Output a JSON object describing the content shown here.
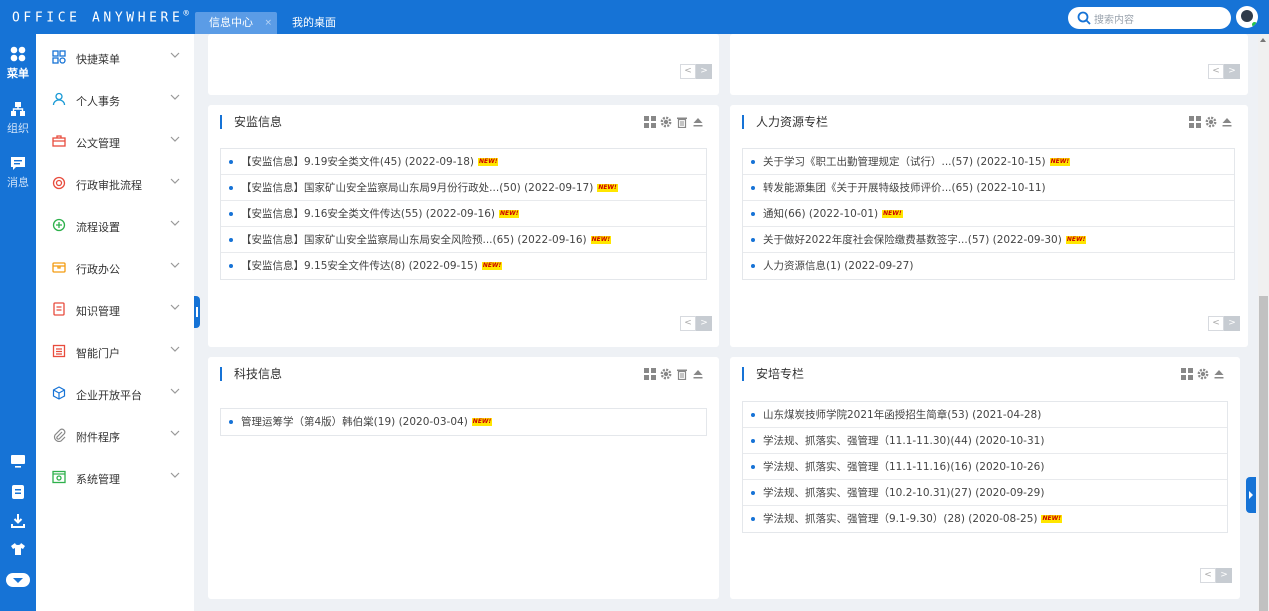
{
  "header": {
    "logo": "OFFICE ANYWHERE",
    "logo_mark": "®",
    "tabs": [
      {
        "label": "信息中心",
        "close": "×"
      },
      {
        "label": "我的桌面"
      }
    ],
    "search_placeholder": "搜索内容"
  },
  "left_nav": [
    {
      "label": "菜单",
      "icon": "apps-icon",
      "active": true
    },
    {
      "label": "组织",
      "icon": "org-icon"
    },
    {
      "label": "消息",
      "icon": "message-icon"
    }
  ],
  "left_bottom_icons": [
    "monitor-icon",
    "note-icon",
    "download-icon",
    "shirt-icon",
    "more-icon"
  ],
  "sidebar": {
    "items": [
      {
        "label": "快捷菜单",
        "icon": "grid-icon",
        "color": "#1673d6"
      },
      {
        "label": "个人事务",
        "icon": "user-icon",
        "color": "#1a9ad6"
      },
      {
        "label": "公文管理",
        "icon": "briefcase-icon",
        "color": "#e84c3d"
      },
      {
        "label": "行政审批流程",
        "icon": "stamp-icon",
        "color": "#e84c3d"
      },
      {
        "label": "流程设置",
        "icon": "flow-icon",
        "color": "#2db04b"
      },
      {
        "label": "行政办公",
        "icon": "office-icon",
        "color": "#f39c12"
      },
      {
        "label": "知识管理",
        "icon": "book-icon",
        "color": "#e84c3d"
      },
      {
        "label": "智能门户",
        "icon": "portal-icon",
        "color": "#e84c3d"
      },
      {
        "label": "企业开放平台",
        "icon": "cube-icon",
        "color": "#1673d6"
      },
      {
        "label": "附件程序",
        "icon": "paperclip-icon",
        "color": "#888888"
      },
      {
        "label": "系统管理",
        "icon": "settings-window-icon",
        "color": "#2db04b"
      }
    ]
  },
  "panels": {
    "anjian": {
      "title": "安监信息",
      "items": [
        {
          "text": "【安监信息】9.19安全类文件(45) (2022-09-18)",
          "new": "NEW!"
        },
        {
          "text": "【安监信息】国家矿山安全监察局山东局9月份行政处...(50) (2022-09-17)",
          "new": "NEW!"
        },
        {
          "text": "【安监信息】9.16安全类文件传达(55) (2022-09-16)",
          "new": "NEW!"
        },
        {
          "text": "【安监信息】国家矿山安全监察局山东局安全风险预...(65) (2022-09-16)",
          "new": "NEW!"
        },
        {
          "text": "【安监信息】9.15安全文件传达(8) (2022-09-15)",
          "new": "NEW!"
        }
      ]
    },
    "renli": {
      "title": "人力资源专栏",
      "items": [
        {
          "text": "关于学习《职工出勤管理规定（试行）...(57) (2022-10-15)",
          "new": "NEW!"
        },
        {
          "text": "转发能源集团《关于开展特级技师评价...(65) (2022-10-11)"
        },
        {
          "text": "通知(66) (2022-10-01)",
          "new": "NEW!"
        },
        {
          "text": "关于做好2022年度社会保险缴费基数签字...(57) (2022-09-30)",
          "new": "NEW!"
        },
        {
          "text": "人力资源信息(1) (2022-09-27)"
        }
      ]
    },
    "keji": {
      "title": "科技信息",
      "items": [
        {
          "text": "管理运筹学（第4版）韩伯棠(19) (2020-03-04)",
          "new": "NEW!"
        }
      ]
    },
    "anpei": {
      "title": "安培专栏",
      "items": [
        {
          "text": "山东煤炭技师学院2021年函授招生简章(53) (2021-04-28)"
        },
        {
          "text": "学法规、抓落实、强管理（11.1-11.30)(44) (2020-10-31)"
        },
        {
          "text": "学法规、抓落实、强管理（11.1-11.16)(16) (2020-10-26)"
        },
        {
          "text": "学法规、抓落实、强管理（10.2-10.31)(27) (2020-09-29)"
        },
        {
          "text": "学法规、抓落实、强管理（9.1-9.30）(28) (2020-08-25)",
          "new": "NEW!"
        }
      ]
    }
  },
  "pager": {
    "prev": "<",
    "next": ">"
  }
}
